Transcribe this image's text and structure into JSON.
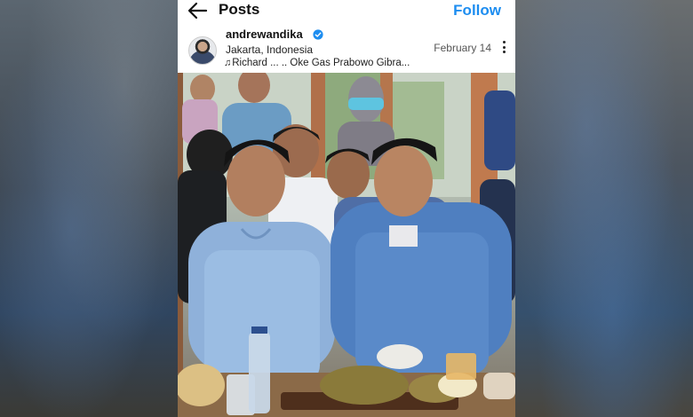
{
  "topbar": {
    "title": "Posts",
    "follow_label": "Follow",
    "back_icon": "back-arrow-icon"
  },
  "post": {
    "username": "andrewandika",
    "verified_icon": "verified-badge-icon",
    "location": "Jakarta, Indonesia",
    "music_prefix": "♫",
    "music_text": "Richard ...  .. Oke Gas Prabowo Gibra...",
    "date": "February 14",
    "more_icon": "more-options-icon"
  },
  "colors": {
    "accent": "#1d8df0",
    "verified": "#1d8df0"
  }
}
